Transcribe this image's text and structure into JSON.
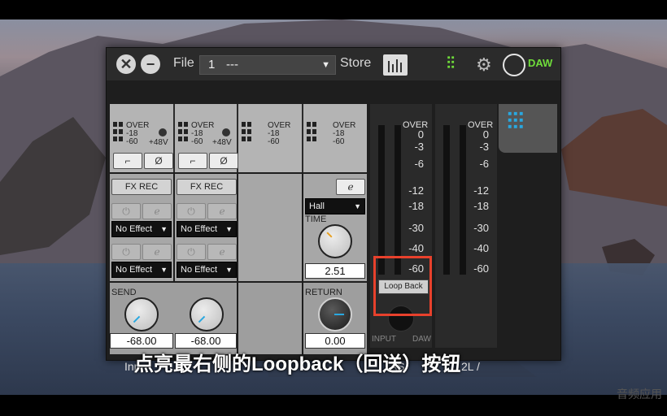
{
  "titlebar": {
    "file_label": "File",
    "file_number": "1",
    "file_name": "---",
    "store_label": "Store",
    "daw_label": "DAW"
  },
  "channels": [
    {
      "levels": [
        "OVER",
        "-18",
        "-60"
      ],
      "phantom": "+48V"
    },
    {
      "levels": [
        "OVER",
        "-18",
        "-60"
      ],
      "phantom": "+48V"
    },
    {
      "levels": [
        "OVER",
        "-18",
        "-60"
      ]
    },
    {
      "levels": [
        "OVER",
        "-18",
        "-60"
      ]
    }
  ],
  "fx": {
    "rec_label_1": "FX REC",
    "rec_label_2": "FX REC",
    "effect_1": "No Effect",
    "effect_2": "No Effect",
    "effect_3": "No Effect",
    "effect_4": "No Effect"
  },
  "reverb": {
    "type": "Hall",
    "time_label": "TIME",
    "time_value": "2.51"
  },
  "send": {
    "label": "SEND",
    "value_1": "-68.00",
    "value_2": "-68.00"
  },
  "return": {
    "label": "RETURN",
    "value": "0.00"
  },
  "meter_scale": [
    "OVER",
    "0",
    "-3",
    "-6",
    "-12",
    "-18",
    "-30",
    "-40",
    "-60"
  ],
  "loopback": {
    "label": "Loop Back",
    "input_label": "INPUT",
    "daw_label": "DAW"
  },
  "bottom": {
    "left_partial": "Inp",
    "mid_partial": "AS",
    "right_partial": "2L /"
  },
  "subtitle": "点亮最右侧的Loopback（回送）按钮",
  "watermark": "音频应用"
}
